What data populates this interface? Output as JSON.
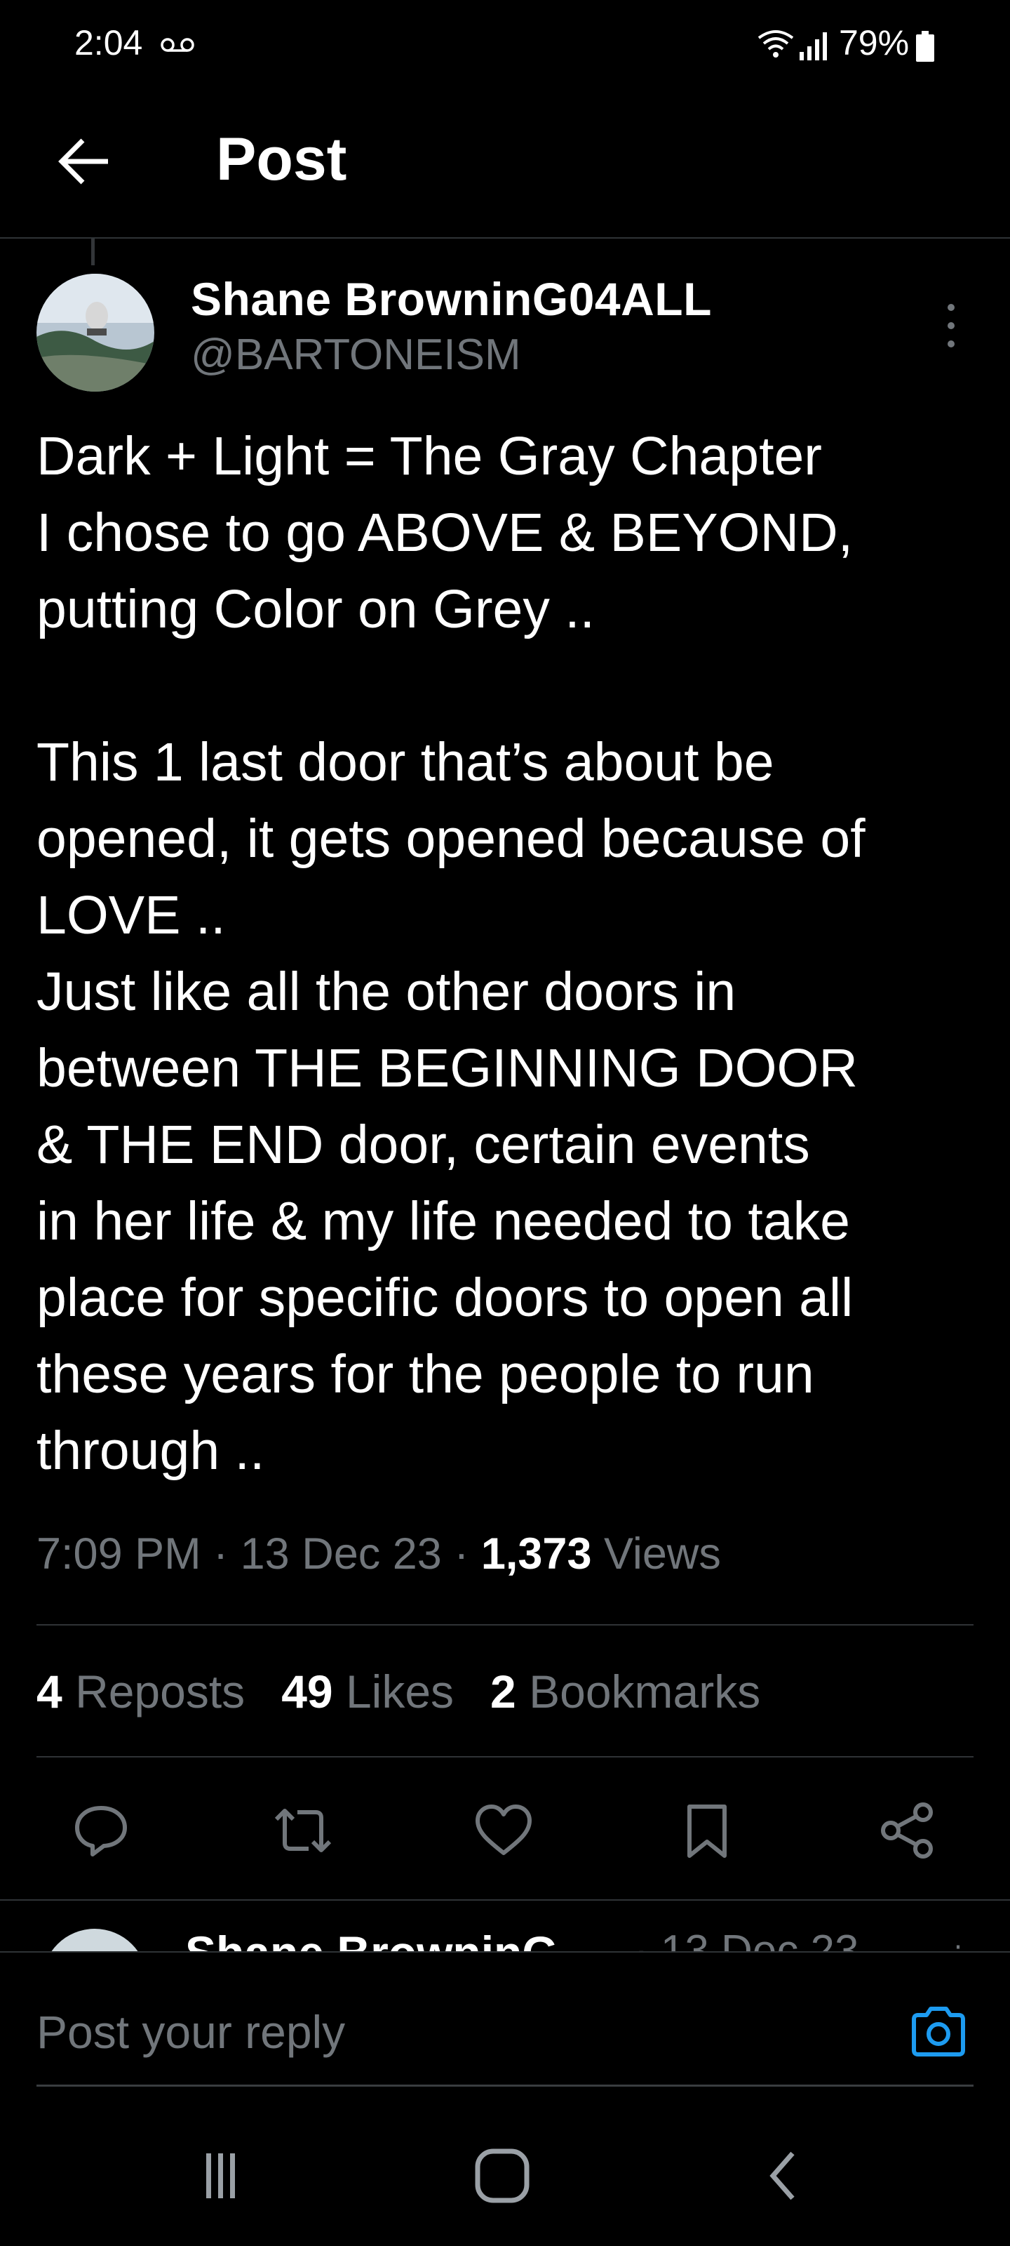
{
  "status_bar": {
    "time": "2:04",
    "battery": "79%"
  },
  "header": {
    "title": "Post"
  },
  "post": {
    "author_name": "Shane BrowninG04ALL",
    "author_handle": "@BARTONEISM",
    "body": "Dark + Light = The Gray Chapter\nI chose to go ABOVE & BEYOND,\nputting Color on Grey ..\n\nThis 1 last door that’s about be\nopened, it gets opened because of\nLOVE ..\nJust like all the other doors in\nbetween THE BEGINNING DOOR\n& THE END door, certain events\nin her life & my life needed to take\nplace for specific doors to open all\nthese years for the people to run\nthrough ..",
    "time": "7:09 PM",
    "date": "13 Dec 23",
    "views_count": "1,373",
    "views_label": "Views",
    "reposts_count": "4",
    "reposts_label": "Reposts",
    "likes_count": "49",
    "likes_label": "Likes",
    "bookmarks_count": "2",
    "bookmarks_label": "Bookmarks"
  },
  "next_reply": {
    "author_name": "Shane BrowninG",
    "date": "· 13 Dec 23"
  },
  "composer": {
    "placeholder": "Post your reply"
  },
  "colors": {
    "background": "#000000",
    "text": "#e7e9ea",
    "muted": "#71767b",
    "accent": "#1d9bf0",
    "divider": "#2f3336"
  },
  "icons": [
    "back-arrow-icon",
    "more-vertical-icon",
    "reply-icon",
    "repost-icon",
    "like-icon",
    "bookmark-icon",
    "share-icon",
    "camera-icon",
    "recents-icon",
    "home-icon",
    "nav-back-icon"
  ]
}
